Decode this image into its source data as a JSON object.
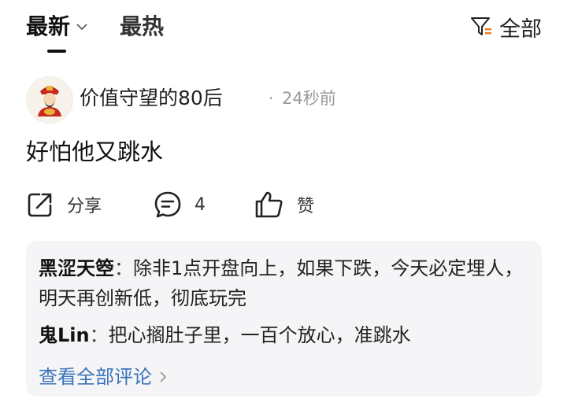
{
  "tabs": {
    "latest": "最新",
    "hot": "最热"
  },
  "filter": {
    "label": "全部",
    "icon": "filter-icon"
  },
  "post": {
    "username": "价值守望的80后",
    "dot": "·",
    "time": "24秒前",
    "content": "好怕他又跳水",
    "avatar_icon": "caishen-avatar"
  },
  "actions": {
    "share": "分享",
    "comment_count": "4",
    "like": "赞"
  },
  "comments": [
    {
      "author": "黑涩天箜",
      "sep": "：",
      "text": "除非1点开盘向上，如果下跌，今天必定埋人，明天再创新低，彻底玩完"
    },
    {
      "author": "鬼Lin",
      "sep": "：",
      "text": "把心搁肚子里，一百个放心，准跳水"
    }
  ],
  "view_all": "查看全部评论",
  "colors": {
    "link": "#3a73b8",
    "panel": "#f5f5f7",
    "accent": "#f07a1a"
  }
}
